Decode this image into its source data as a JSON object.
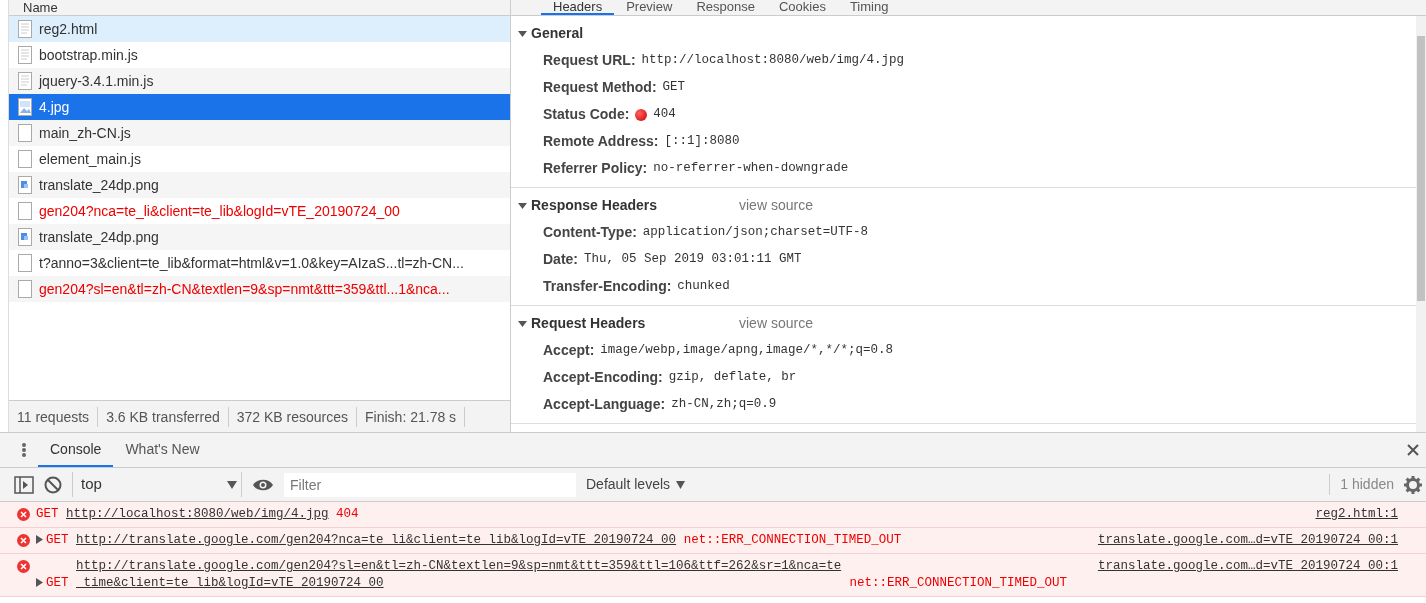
{
  "network": {
    "column_header": "Name",
    "requests": [
      {
        "name": "reg2.html",
        "kind": "document",
        "error": false,
        "selected": false,
        "highlighted": true
      },
      {
        "name": "bootstrap.min.js",
        "kind": "document",
        "error": false,
        "selected": false,
        "highlighted": false
      },
      {
        "name": "jquery-3.4.1.min.js",
        "kind": "document",
        "error": false,
        "selected": false,
        "highlighted": false
      },
      {
        "name": "4.jpg",
        "kind": "image",
        "error": false,
        "selected": true,
        "highlighted": false
      },
      {
        "name": "main_zh-CN.js",
        "kind": "blank",
        "error": false,
        "selected": false,
        "highlighted": false
      },
      {
        "name": "element_main.js",
        "kind": "blank",
        "error": false,
        "selected": false,
        "highlighted": false
      },
      {
        "name": "translate_24dp.png",
        "kind": "picture",
        "error": false,
        "selected": false,
        "highlighted": false
      },
      {
        "name": "gen204?nca=te_li&client=te_lib&logId=vTE_20190724_00",
        "kind": "blank",
        "error": true,
        "selected": false,
        "highlighted": false
      },
      {
        "name": "translate_24dp.png",
        "kind": "picture",
        "error": false,
        "selected": false,
        "highlighted": false
      },
      {
        "name": "t?anno=3&client=te_lib&format=html&v=1.0&key=AIzaS...tl=zh-CN...",
        "kind": "blank",
        "error": false,
        "selected": false,
        "highlighted": false
      },
      {
        "name": "gen204?sl=en&tl=zh-CN&textlen=9&sp=nmt&ttt=359&ttl...1&nca...",
        "kind": "blank",
        "error": true,
        "selected": false,
        "highlighted": false
      }
    ],
    "summary": [
      "11 requests",
      "3.6 KB transferred",
      "372 KB resources",
      "Finish: 21.78 s"
    ]
  },
  "details": {
    "tabs": [
      {
        "label": "Headers",
        "selected": true
      },
      {
        "label": "Preview",
        "selected": false
      },
      {
        "label": "Response",
        "selected": false
      },
      {
        "label": "Cookies",
        "selected": false
      },
      {
        "label": "Timing",
        "selected": false
      }
    ],
    "sections": [
      {
        "title": "General",
        "expanded": true,
        "fields": [
          {
            "kind": "text",
            "key": "Request URL:",
            "value": "http://localhost:8080/web/img/4.jpg"
          },
          {
            "kind": "text",
            "key": "Request Method:",
            "value": "GET"
          },
          {
            "kind": "status",
            "key": "Status Code:",
            "value": "404"
          },
          {
            "kind": "text",
            "key": "Remote Address:",
            "value": "[::1]:8080"
          },
          {
            "kind": "text",
            "key": "Referrer Policy:",
            "value": "no-referrer-when-downgrade"
          }
        ]
      },
      {
        "title": "Response Headers",
        "expanded": true,
        "link": "view source",
        "fields": [
          {
            "kind": "text",
            "key": "Content-Type:",
            "value": "application/json;charset=UTF-8"
          },
          {
            "kind": "text",
            "key": "Date:",
            "value": "Thu, 05 Sep 2019 03:01:11 GMT"
          },
          {
            "kind": "text",
            "key": "Transfer-Encoding:",
            "value": "chunked"
          }
        ]
      },
      {
        "title": "Request Headers",
        "expanded": true,
        "link": "view source",
        "fields": [
          {
            "kind": "text",
            "key": "Accept:",
            "value": "image/webp,image/apng,image/*,*/*;q=0.8"
          },
          {
            "kind": "text",
            "key": "Accept-Encoding:",
            "value": "gzip, deflate, br"
          },
          {
            "kind": "text",
            "key": "Accept-Language:",
            "value": "zh-CN,zh;q=0.9"
          }
        ]
      }
    ]
  },
  "console": {
    "tabs": [
      {
        "label": "Console",
        "selected": true
      },
      {
        "label": "What's New",
        "selected": false
      }
    ],
    "context": "top",
    "filter": {
      "placeholder": "Filter"
    },
    "levels": "Default levels",
    "hidden": "1 hidden",
    "messages": [
      {
        "expandable": false,
        "method": "GET",
        "url": "http://localhost:8080/web/img/4.jpg",
        "status": "404",
        "source": "reg2.html:1"
      },
      {
        "expandable": true,
        "method": "GET",
        "url": "http://translate.google.com/gen204?nca=te_li&client=te_lib&logId=vTE_20190724_00",
        "status": "net::ERR_CONNECTION_TIMED_OUT",
        "source": "translate.google.com…d=vTE_20190724_00:1"
      },
      {
        "expandable": true,
        "method": "GET",
        "url": "http://translate.google.com/gen204?sl=en&tl=zh-CN&textlen=9&sp=nmt&ttt=359&ttl=106&ttf=262&sr=1&nca=te_time&client=te_lib&logId=vTE_20190724_00",
        "status": "net::ERR_CONNECTION_TIMED_OUT",
        "source": "translate.google.com…d=vTE_20190724_00:1"
      }
    ]
  }
}
